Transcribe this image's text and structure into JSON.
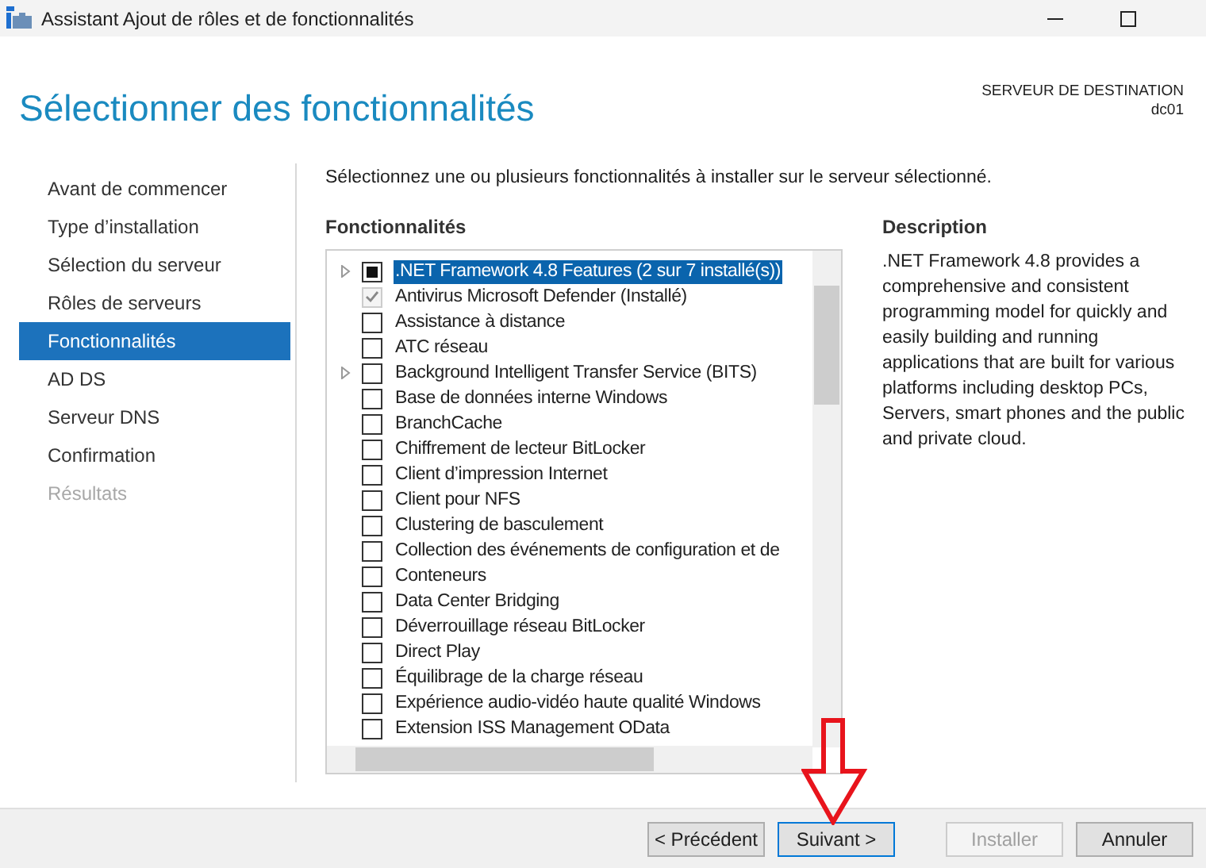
{
  "window": {
    "title": "Assistant Ajout de rôles et de fonctionnalités"
  },
  "page_title": "Sélectionner des fonctionnalités",
  "destination": {
    "label": "SERVEUR DE DESTINATION",
    "server": "dc01"
  },
  "steps": [
    {
      "label": "Avant de commencer",
      "selected": false,
      "disabled": false
    },
    {
      "label": "Type d’installation",
      "selected": false,
      "disabled": false
    },
    {
      "label": "Sélection du serveur",
      "selected": false,
      "disabled": false
    },
    {
      "label": "Rôles de serveurs",
      "selected": false,
      "disabled": false
    },
    {
      "label": "Fonctionnalités",
      "selected": true,
      "disabled": false
    },
    {
      "label": "AD DS",
      "selected": false,
      "disabled": false
    },
    {
      "label": "Serveur DNS",
      "selected": false,
      "disabled": false
    },
    {
      "label": "Confirmation",
      "selected": false,
      "disabled": false
    },
    {
      "label": "Résultats",
      "selected": false,
      "disabled": true
    }
  ],
  "instruction": "Sélectionnez une ou plusieurs fonctionnalités à installer sur le serveur sélectionné.",
  "features_heading": "Fonctionnalités",
  "features": [
    {
      "label": ".NET Framework 4.8 Features (2 sur 7 installé(s))",
      "checked": false,
      "partial": true,
      "disabled": false,
      "expandable": true,
      "selected": true
    },
    {
      "label": "Antivirus Microsoft Defender (Installé)",
      "checked": true,
      "partial": false,
      "disabled": true,
      "expandable": false,
      "selected": false
    },
    {
      "label": "Assistance à distance",
      "checked": false,
      "partial": false,
      "disabled": false,
      "expandable": false,
      "selected": false
    },
    {
      "label": "ATC réseau",
      "checked": false,
      "partial": false,
      "disabled": false,
      "expandable": false,
      "selected": false
    },
    {
      "label": "Background Intelligent Transfer Service (BITS)",
      "checked": false,
      "partial": false,
      "disabled": false,
      "expandable": true,
      "selected": false
    },
    {
      "label": "Base de données interne Windows",
      "checked": false,
      "partial": false,
      "disabled": false,
      "expandable": false,
      "selected": false
    },
    {
      "label": "BranchCache",
      "checked": false,
      "partial": false,
      "disabled": false,
      "expandable": false,
      "selected": false
    },
    {
      "label": "Chiffrement de lecteur BitLocker",
      "checked": false,
      "partial": false,
      "disabled": false,
      "expandable": false,
      "selected": false
    },
    {
      "label": "Client d’impression Internet",
      "checked": false,
      "partial": false,
      "disabled": false,
      "expandable": false,
      "selected": false
    },
    {
      "label": "Client pour NFS",
      "checked": false,
      "partial": false,
      "disabled": false,
      "expandable": false,
      "selected": false
    },
    {
      "label": "Clustering de basculement",
      "checked": false,
      "partial": false,
      "disabled": false,
      "expandable": false,
      "selected": false
    },
    {
      "label": "Collection des événements de configuration et de",
      "checked": false,
      "partial": false,
      "disabled": false,
      "expandable": false,
      "selected": false
    },
    {
      "label": "Conteneurs",
      "checked": false,
      "partial": false,
      "disabled": false,
      "expandable": false,
      "selected": false
    },
    {
      "label": "Data Center Bridging",
      "checked": false,
      "partial": false,
      "disabled": false,
      "expandable": false,
      "selected": false
    },
    {
      "label": "Déverrouillage réseau BitLocker",
      "checked": false,
      "partial": false,
      "disabled": false,
      "expandable": false,
      "selected": false
    },
    {
      "label": "Direct Play",
      "checked": false,
      "partial": false,
      "disabled": false,
      "expandable": false,
      "selected": false
    },
    {
      "label": "Équilibrage de la charge réseau",
      "checked": false,
      "partial": false,
      "disabled": false,
      "expandable": false,
      "selected": false
    },
    {
      "label": "Expérience audio-vidéo haute qualité Windows",
      "checked": false,
      "partial": false,
      "disabled": false,
      "expandable": false,
      "selected": false
    },
    {
      "label": "Extension ISS Management OData",
      "checked": false,
      "partial": false,
      "disabled": false,
      "expandable": false,
      "selected": false
    }
  ],
  "description": {
    "heading": "Description",
    "text": ".NET Framework 4.8 provides a comprehensive and consistent programming model for quickly and easily building and running applications that are built for various platforms including desktop PCs, Servers, smart phones and the public and private cloud."
  },
  "buttons": [
    {
      "label": "< Précédent",
      "disabled": false,
      "focused": false
    },
    {
      "label": "Suivant >",
      "disabled": false,
      "focused": true
    },
    {
      "label": "Installer",
      "disabled": true,
      "focused": false
    },
    {
      "label": "Annuler",
      "disabled": false,
      "focused": false
    }
  ]
}
